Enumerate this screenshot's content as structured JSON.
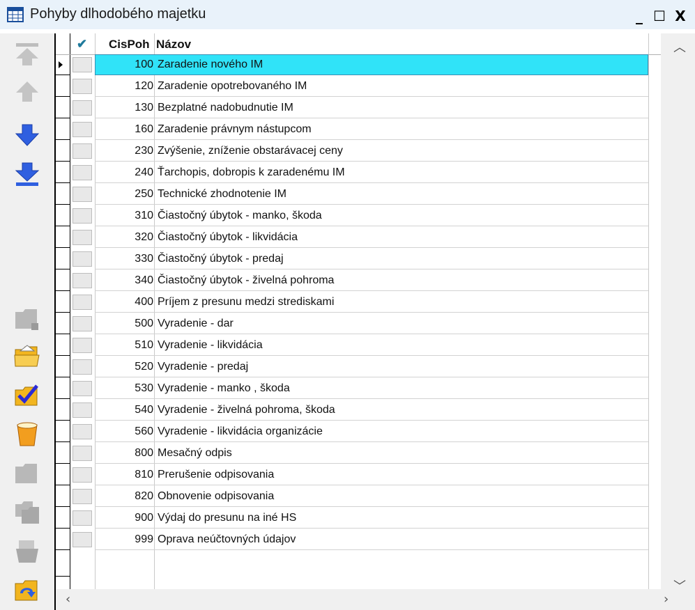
{
  "window": {
    "title": "Pohyby dlhodobého majetku",
    "minimize": "_",
    "maximize": "☐",
    "close": "X"
  },
  "grid": {
    "columns": {
      "check": "✔",
      "code": "CisPoh",
      "name": "Názov"
    },
    "rows": [
      {
        "code": "100",
        "name": "Zaradenie nového IM",
        "selected": true
      },
      {
        "code": "120",
        "name": "Zaradenie opotrebovaného IM"
      },
      {
        "code": "130",
        "name": "Bezplatné nadobudnutie IM"
      },
      {
        "code": "160",
        "name": "Zaradenie právnym nástupcom"
      },
      {
        "code": "230",
        "name": "Zvýšenie, zníženie obstarávacej ceny"
      },
      {
        "code": "240",
        "name": "Ťarchopis, dobropis k zaradenému IM"
      },
      {
        "code": "250",
        "name": "Technické zhodnotenie IM"
      },
      {
        "code": "310",
        "name": "Čiastočný úbytok - manko, škoda"
      },
      {
        "code": "320",
        "name": "Čiastočný úbytok - likvidácia"
      },
      {
        "code": "330",
        "name": "Čiastočný úbytok - predaj"
      },
      {
        "code": "340",
        "name": "Čiastočný úbytok - živelná pohroma"
      },
      {
        "code": "400",
        "name": "Príjem z presunu medzi strediskami"
      },
      {
        "code": "500",
        "name": "Vyradenie - dar"
      },
      {
        "code": "510",
        "name": "Vyradenie - likvidácia"
      },
      {
        "code": "520",
        "name": "Vyradenie - predaj"
      },
      {
        "code": "530",
        "name": "Vyradenie - manko , škoda"
      },
      {
        "code": "540",
        "name": "Vyradenie - živelná pohroma, škoda"
      },
      {
        "code": "560",
        "name": "Vyradenie - likvidácia organizácie"
      },
      {
        "code": "800",
        "name": "Mesačný odpis"
      },
      {
        "code": "810",
        "name": "Prerušenie odpisovania"
      },
      {
        "code": "820",
        "name": "Obnovenie odpisovania"
      },
      {
        "code": "900",
        "name": "Výdaj do presunu na iné HS"
      },
      {
        "code": "999",
        "name": "Oprava neúčtovných údajov"
      }
    ]
  },
  "toolbar": {
    "icons": [
      "first-record-icon",
      "previous-record-icon",
      "next-record-icon",
      "last-record-icon",
      "new-folder-icon",
      "open-folder-icon",
      "checklist-icon",
      "delete-bin-icon",
      "folder-icon",
      "copy-folder-icon",
      "print-icon",
      "refresh-folder-icon"
    ]
  },
  "colors": {
    "selection": "#30e3f8",
    "title_bar": "#e9f2fa",
    "arrow_blue": "#2f5fe0"
  }
}
